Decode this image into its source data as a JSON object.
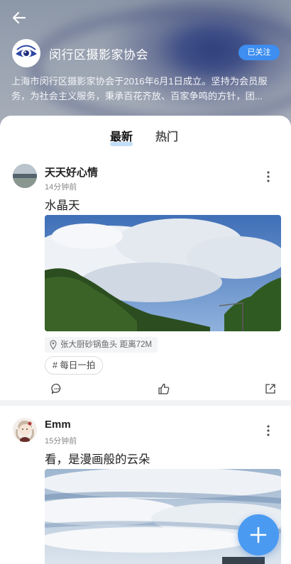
{
  "header": {
    "club_name": "闵行区摄影家协会",
    "follow_label": "已关注",
    "description": "上海市闵行区摄影家协会于2016年6月1日成立。坚持为会员服务，为社会主义服务，秉承百花齐放、百家争鸣的方针，团..."
  },
  "tabs": [
    {
      "label": "最新",
      "active": true
    },
    {
      "label": "热门",
      "active": false
    }
  ],
  "posts": [
    {
      "user": "天天好心情",
      "time": "14分钟前",
      "text": "水晶天",
      "location": "张大厨砂锅鱼头 距离72M",
      "topic": "# 每日一拍"
    },
    {
      "user": "Emm",
      "time": "15分钟前",
      "text": "看，是漫画般的云朵"
    }
  ],
  "colors": {
    "accent": "#3d8ef0",
    "fab": "#4a9af1"
  },
  "icons": {
    "back": "arrow-left-icon",
    "more": "vertical-dots-icon",
    "comment": "comment-icon",
    "like": "thumbs-up-icon",
    "share": "share-icon",
    "location": "location-pin-icon",
    "add": "plus-icon"
  }
}
